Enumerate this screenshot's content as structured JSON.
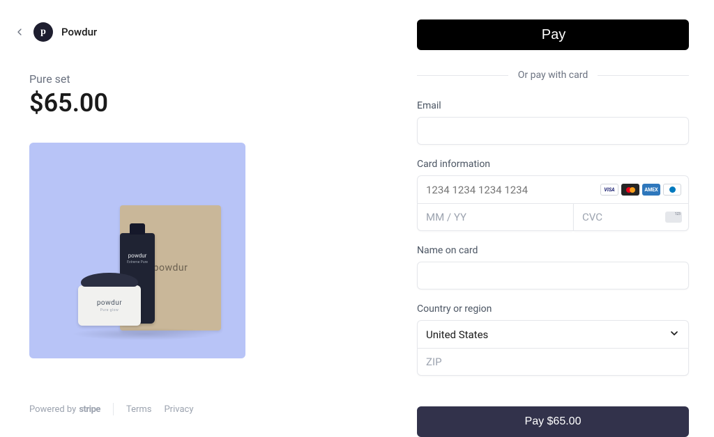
{
  "merchant": {
    "logo_letter": "p",
    "name": "Powdur"
  },
  "product": {
    "name": "Pure set",
    "price_display": "$65.00",
    "image_labels": {
      "box": "powdur",
      "tube": "powdur",
      "tube_sub": "Extreme Pure",
      "jar": "powdur",
      "jar_sub": "Pure glow"
    }
  },
  "footer": {
    "powered_by": "Powered by",
    "stripe": "stripe",
    "terms": "Terms",
    "privacy": "Privacy"
  },
  "payment": {
    "apple_pay_label": "Pay",
    "or_divider": "Or pay with card",
    "email_label": "Email",
    "email_value": "",
    "card_label": "Card information",
    "card_number_placeholder": "1234 1234 1234 1234",
    "card_number_value": "",
    "expiry_placeholder": "MM / YY",
    "expiry_value": "",
    "cvc_placeholder": "CVC",
    "cvc_value": "",
    "cvc_badge": "123",
    "name_label": "Name on card",
    "name_value": "",
    "country_label": "Country or region",
    "country_selected": "United States",
    "zip_placeholder": "ZIP",
    "zip_value": "",
    "pay_button": "Pay $65.00",
    "card_brands": {
      "visa": "VISA",
      "amex": "AMEX"
    }
  }
}
